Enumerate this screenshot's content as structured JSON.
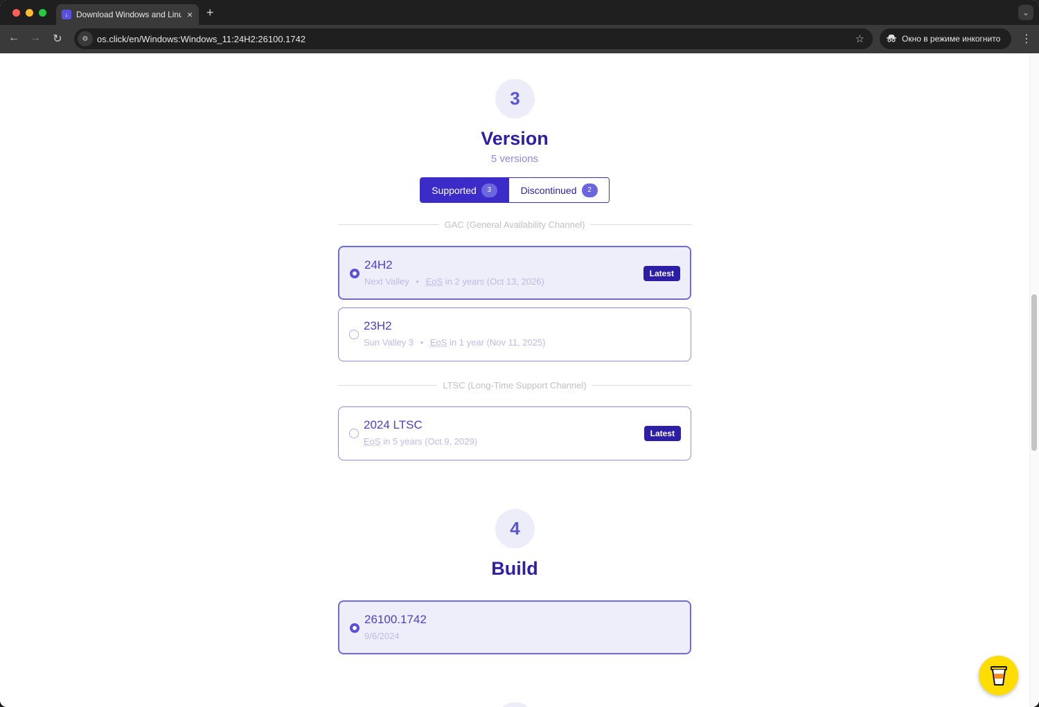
{
  "browser": {
    "tab_title": "Download Windows and Linux",
    "tab_close": "×",
    "new_tab": "+",
    "url": "os.click/en/Windows:Windows_11:24H2:26100.1742",
    "incognito_label": "Окно в режиме инкогнито",
    "icons": [
      "back-arrow-icon",
      "forward-arrow-icon",
      "reload-icon",
      "site-info-icon",
      "star-icon",
      "incognito-icon",
      "kebab-menu-icon"
    ]
  },
  "version_section": {
    "step_number": "3",
    "title": "Version",
    "subtitle": "5 versions",
    "filters": {
      "supported_label": "Supported",
      "supported_count": "3",
      "discontinued_label": "Discontinued",
      "discontinued_count": "2"
    },
    "gac_divider": "GAC (General Availability Channel)",
    "ltsc_divider": "LTSC (Long-Time Support Channel)",
    "versions": [
      {
        "name": "24H2",
        "codename": "Next Valley",
        "sep": "•",
        "eos": "EoS",
        "eos_rest": " in 2 years (Oct 13, 2026)",
        "badge": "Latest",
        "selected": true
      },
      {
        "name": "23H2",
        "codename": "Sun Valley 3",
        "sep": "•",
        "eos": "EoS",
        "eos_rest": " in 1 year (Nov 11, 2025)",
        "badge": "",
        "selected": false
      },
      {
        "name": "2024 LTSC",
        "codename": "",
        "sep": "",
        "eos": "EoS",
        "eos_rest": " in 5 years (Oct 9, 2029)",
        "badge": "Latest",
        "selected": false
      }
    ]
  },
  "build_section": {
    "step_number": "4",
    "title": "Build",
    "builds": [
      {
        "name": "26100.1742",
        "date": "9/6/2024",
        "selected": true
      }
    ]
  },
  "colors": {
    "accent": "#3b2bc9",
    "title": "#2d1ea6",
    "selected_bg": "#eeeefb",
    "coffee_button": "#ffdd00"
  }
}
